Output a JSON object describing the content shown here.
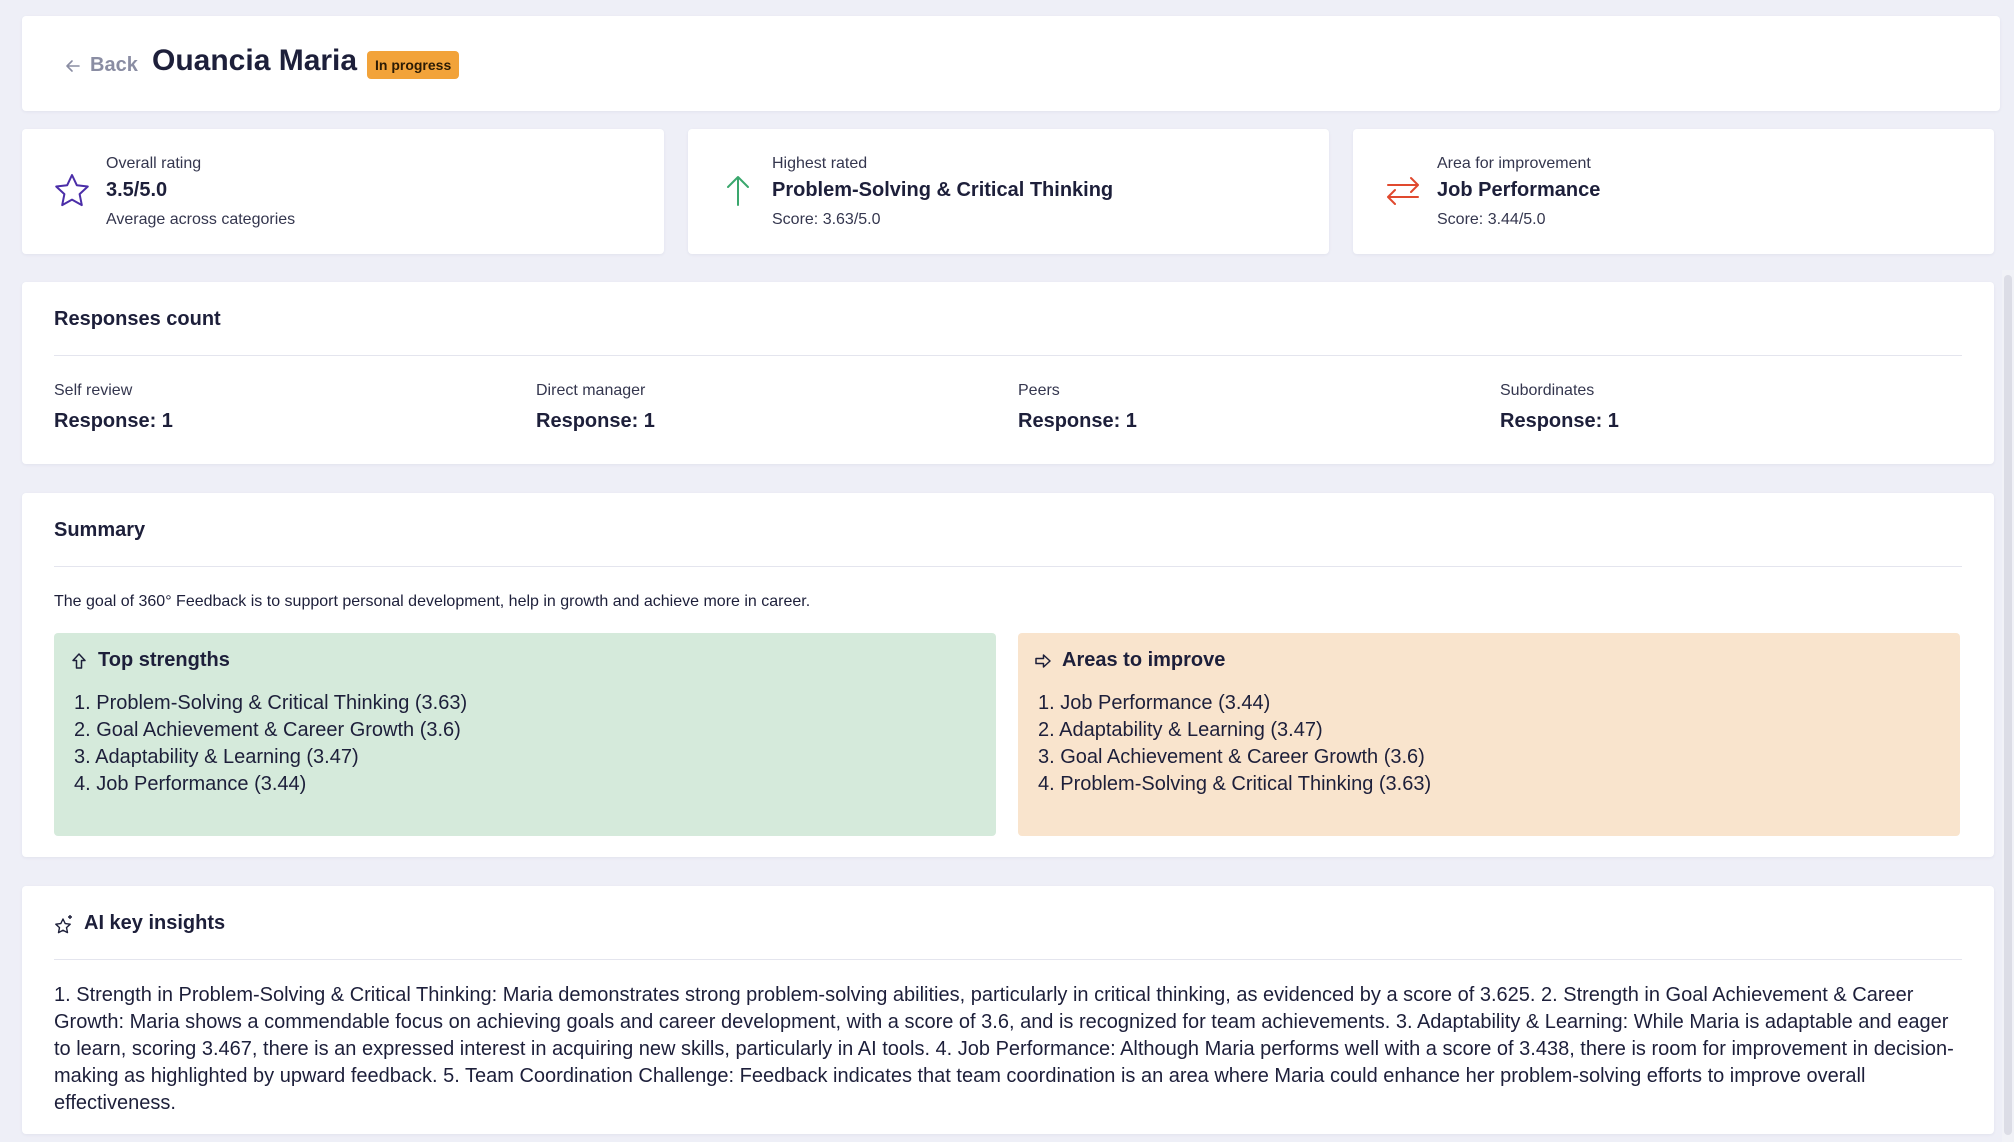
{
  "header": {
    "back_label": "Back",
    "name": "Ouancia Maria",
    "status": "In progress",
    "status_color": "#f2a33a"
  },
  "stats": [
    {
      "label": "Overall rating",
      "value": "3.5/5.0",
      "sub": "Average across categories",
      "icon": "star-icon",
      "icon_color": "#4b2ea8"
    },
    {
      "label": "Highest rated",
      "value": "Problem-Solving & Critical Thinking",
      "sub": "Score: 3.63/5.0",
      "icon": "arrow-up-icon",
      "icon_color": "#3aa76d"
    },
    {
      "label": "Area for improvement",
      "value": "Job Performance",
      "sub": "Score: 3.44/5.0",
      "icon": "swap-arrows-icon",
      "icon_color": "#e0492e"
    }
  ],
  "responses": {
    "title": "Responses count",
    "items": [
      {
        "label": "Self review",
        "value": "Response: 1"
      },
      {
        "label": "Direct manager",
        "value": "Response: 1"
      },
      {
        "label": "Peers",
        "value": "Response: 1"
      },
      {
        "label": "Subordinates",
        "value": "Response: 1"
      }
    ]
  },
  "summary": {
    "title": "Summary",
    "description": "The goal of 360° Feedback is to support personal development, help in growth and achieve more in career.",
    "strengths": {
      "title": "Top strengths",
      "bg_color": "#d5eadb",
      "items": [
        "1. Problem-Solving & Critical Thinking (3.63)",
        "2. Goal Achievement & Career Growth (3.6)",
        "3. Adaptability & Learning (3.47)",
        "4. Job Performance (3.44)"
      ]
    },
    "improve": {
      "title": "Areas to improve",
      "bg_color": "#f9e4cd",
      "items": [
        "1. Job Performance (3.44)",
        "2. Adaptability & Learning (3.47)",
        "3. Goal Achievement & Career Growth (3.6)",
        "4. Problem-Solving & Critical Thinking (3.63)"
      ]
    }
  },
  "insights": {
    "title": "AI key insights",
    "text": "1. Strength in Problem-Solving & Critical Thinking: Maria demonstrates strong problem-solving abilities, particularly in critical thinking, as evidenced by a score of 3.625. 2. Strength in Goal Achievement & Career Growth: Maria shows a commendable focus on achieving goals and career development, with a score of 3.6, and is recognized for team achievements. 3. Adaptability & Learning: While Maria is adaptable and eager to learn, scoring 3.467, there is an expressed interest in acquiring new skills, particularly in AI tools. 4. Job Performance: Although Maria performs well with a score of 3.438, there is room for improvement in decision-making as highlighted by upward feedback. 5. Team Coordination Challenge: Feedback indicates that team coordination is an area where Maria could enhance her problem-solving efforts to improve overall effectiveness."
  }
}
